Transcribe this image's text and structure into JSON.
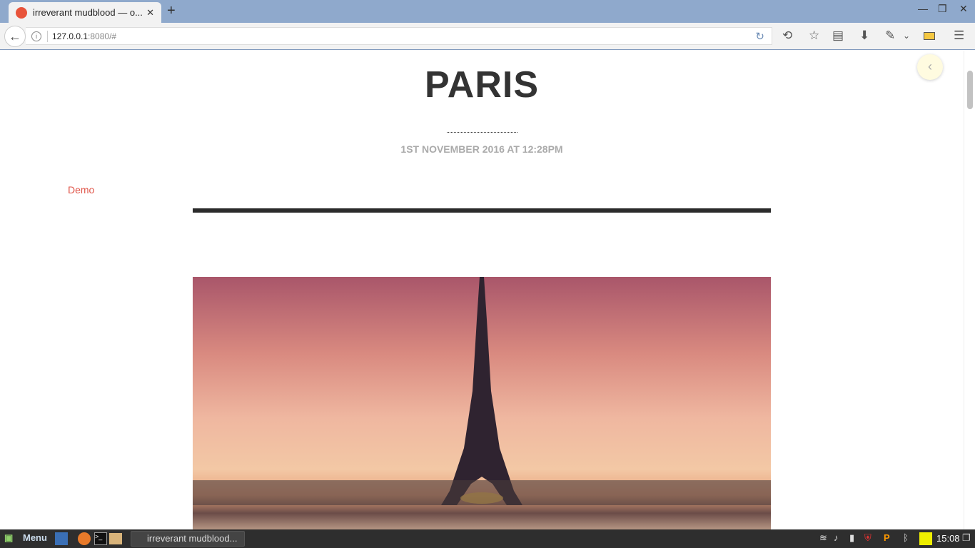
{
  "browser": {
    "tab_title": "irreverant mudblood — o...",
    "url_host": "127.0.0.1",
    "url_path": ":8080/#"
  },
  "page": {
    "title": "PARIS",
    "date": "1ST NOVEMBER 2016 AT 12:28PM",
    "category": "Demo"
  },
  "taskbar": {
    "menu_label": "Menu",
    "window_label": "irreverant mudblood...",
    "clock": "15:08"
  }
}
